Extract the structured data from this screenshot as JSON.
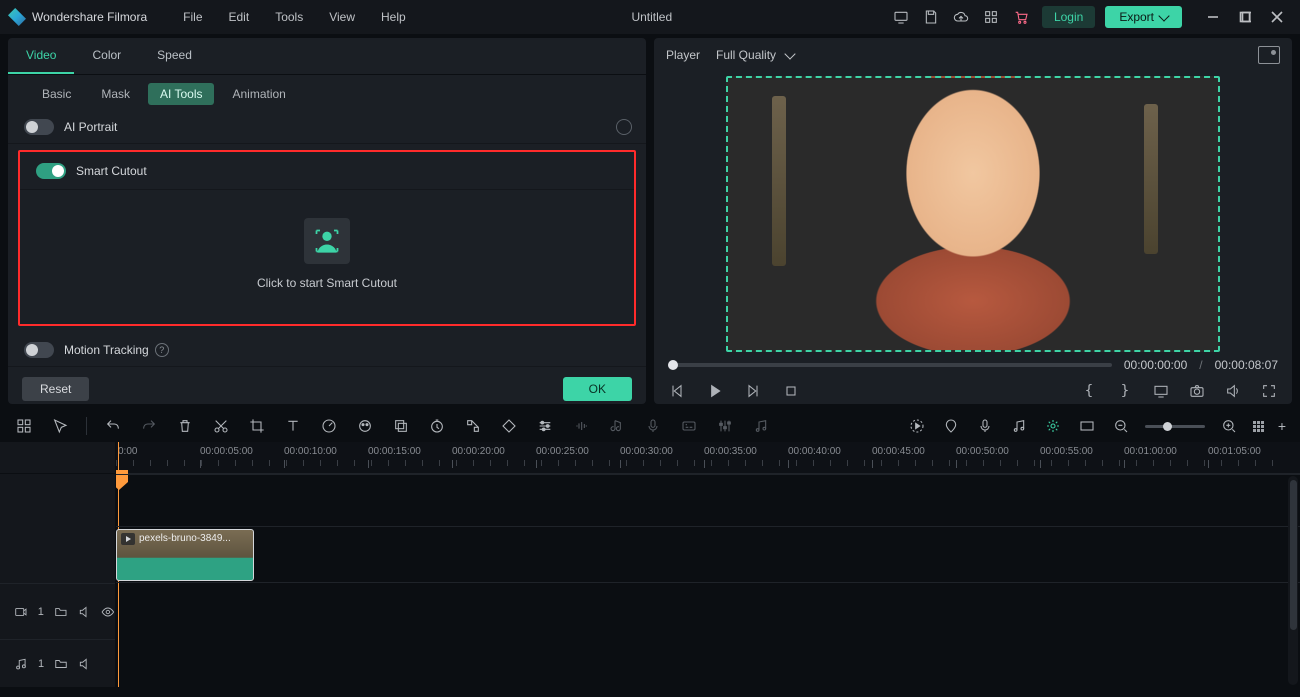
{
  "app": {
    "name": "Wondershare Filmora",
    "document_title": "Untitled"
  },
  "menubar": [
    "File",
    "Edit",
    "Tools",
    "View",
    "Help"
  ],
  "titlebar": {
    "login": "Login",
    "export": "Export"
  },
  "tabs": {
    "items": [
      "Video",
      "Color",
      "Speed"
    ],
    "active": 0
  },
  "subtabs": {
    "items": [
      "Basic",
      "Mask",
      "AI Tools",
      "Animation"
    ],
    "active": 2
  },
  "ai_panel": {
    "ai_portrait": {
      "label": "AI Portrait",
      "on": false
    },
    "smart_cutout": {
      "label": "Smart Cutout",
      "on": true,
      "hint": "Click to start Smart Cutout"
    },
    "motion_tracking": {
      "label": "Motion Tracking",
      "on": false
    }
  },
  "panel_buttons": {
    "reset": "Reset",
    "ok": "OK"
  },
  "player": {
    "label": "Player",
    "quality": "Full Quality",
    "current": "00:00:00:00",
    "duration": "00:00:08:07"
  },
  "ruler": {
    "start_label": "0:00",
    "ticks": [
      "00:00:05:00",
      "00:00:10:00",
      "00:00:15:00",
      "00:00:20:00",
      "00:00:25:00",
      "00:00:30:00",
      "00:00:35:00",
      "00:00:40:00",
      "00:00:45:00",
      "00:00:50:00",
      "00:00:55:00",
      "00:01:00:00",
      "00:01:05:00"
    ]
  },
  "tracks": {
    "video": {
      "index": "1",
      "clip_name": "pexels-bruno-3849..."
    },
    "audio": {
      "index": "1"
    }
  }
}
